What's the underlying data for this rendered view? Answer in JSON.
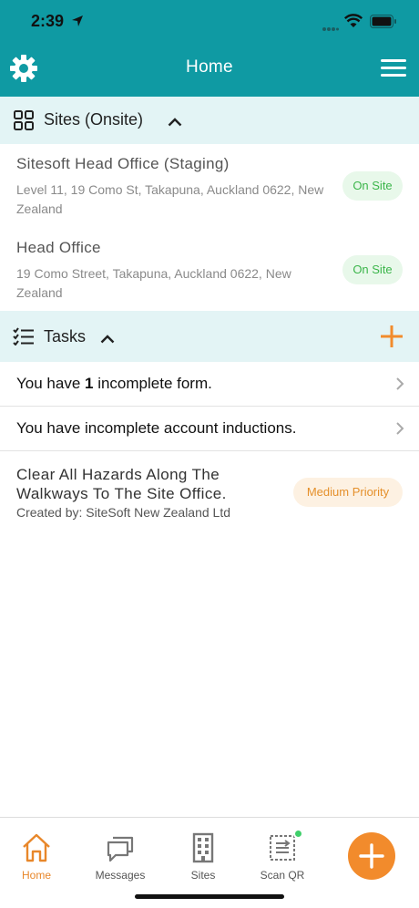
{
  "status_bar": {
    "time": "2:39"
  },
  "header": {
    "title": "Home",
    "settings_icon": "gear-icon",
    "menu_icon": "hamburger-menu-icon"
  },
  "sites": {
    "title": "Sites (Onsite)",
    "items": [
      {
        "name": "Sitesoft Head Office (Staging)",
        "address": "Level 11, 19 Como St, Takapuna, Auckland 0622, New Zealand",
        "badge": "On Site"
      },
      {
        "name": "Head Office",
        "address": "19 Como Street, Takapuna, Auckland 0622, New Zealand",
        "badge": "On Site"
      }
    ]
  },
  "tasks": {
    "title": "Tasks",
    "incomplete_forms": {
      "prefix": "You have ",
      "count": "1",
      "suffix": " incomplete form."
    },
    "inductions": "You have incomplete account inductions.",
    "hazard": {
      "title": "Clear All Hazards Along The Walkways To The Site Office.",
      "creator": "Created by: SiteSoft New Zealand Ltd",
      "priority": "Medium Priority"
    }
  },
  "tab_bar": {
    "tabs": [
      {
        "label": "Home",
        "icon": "home-icon",
        "active": true
      },
      {
        "label": "Messages",
        "icon": "messages-icon"
      },
      {
        "label": "Sites",
        "icon": "building-icon"
      },
      {
        "label": "Scan QR",
        "icon": "scan-qr-icon"
      }
    ],
    "fab_icon": "plus-icon"
  },
  "colors": {
    "header": "#0f9aa3",
    "section_bg": "#e3f4f5",
    "accent": "#f28b2c",
    "on_site_green": "#3bb54a",
    "priority_orange": "#e5902b"
  }
}
